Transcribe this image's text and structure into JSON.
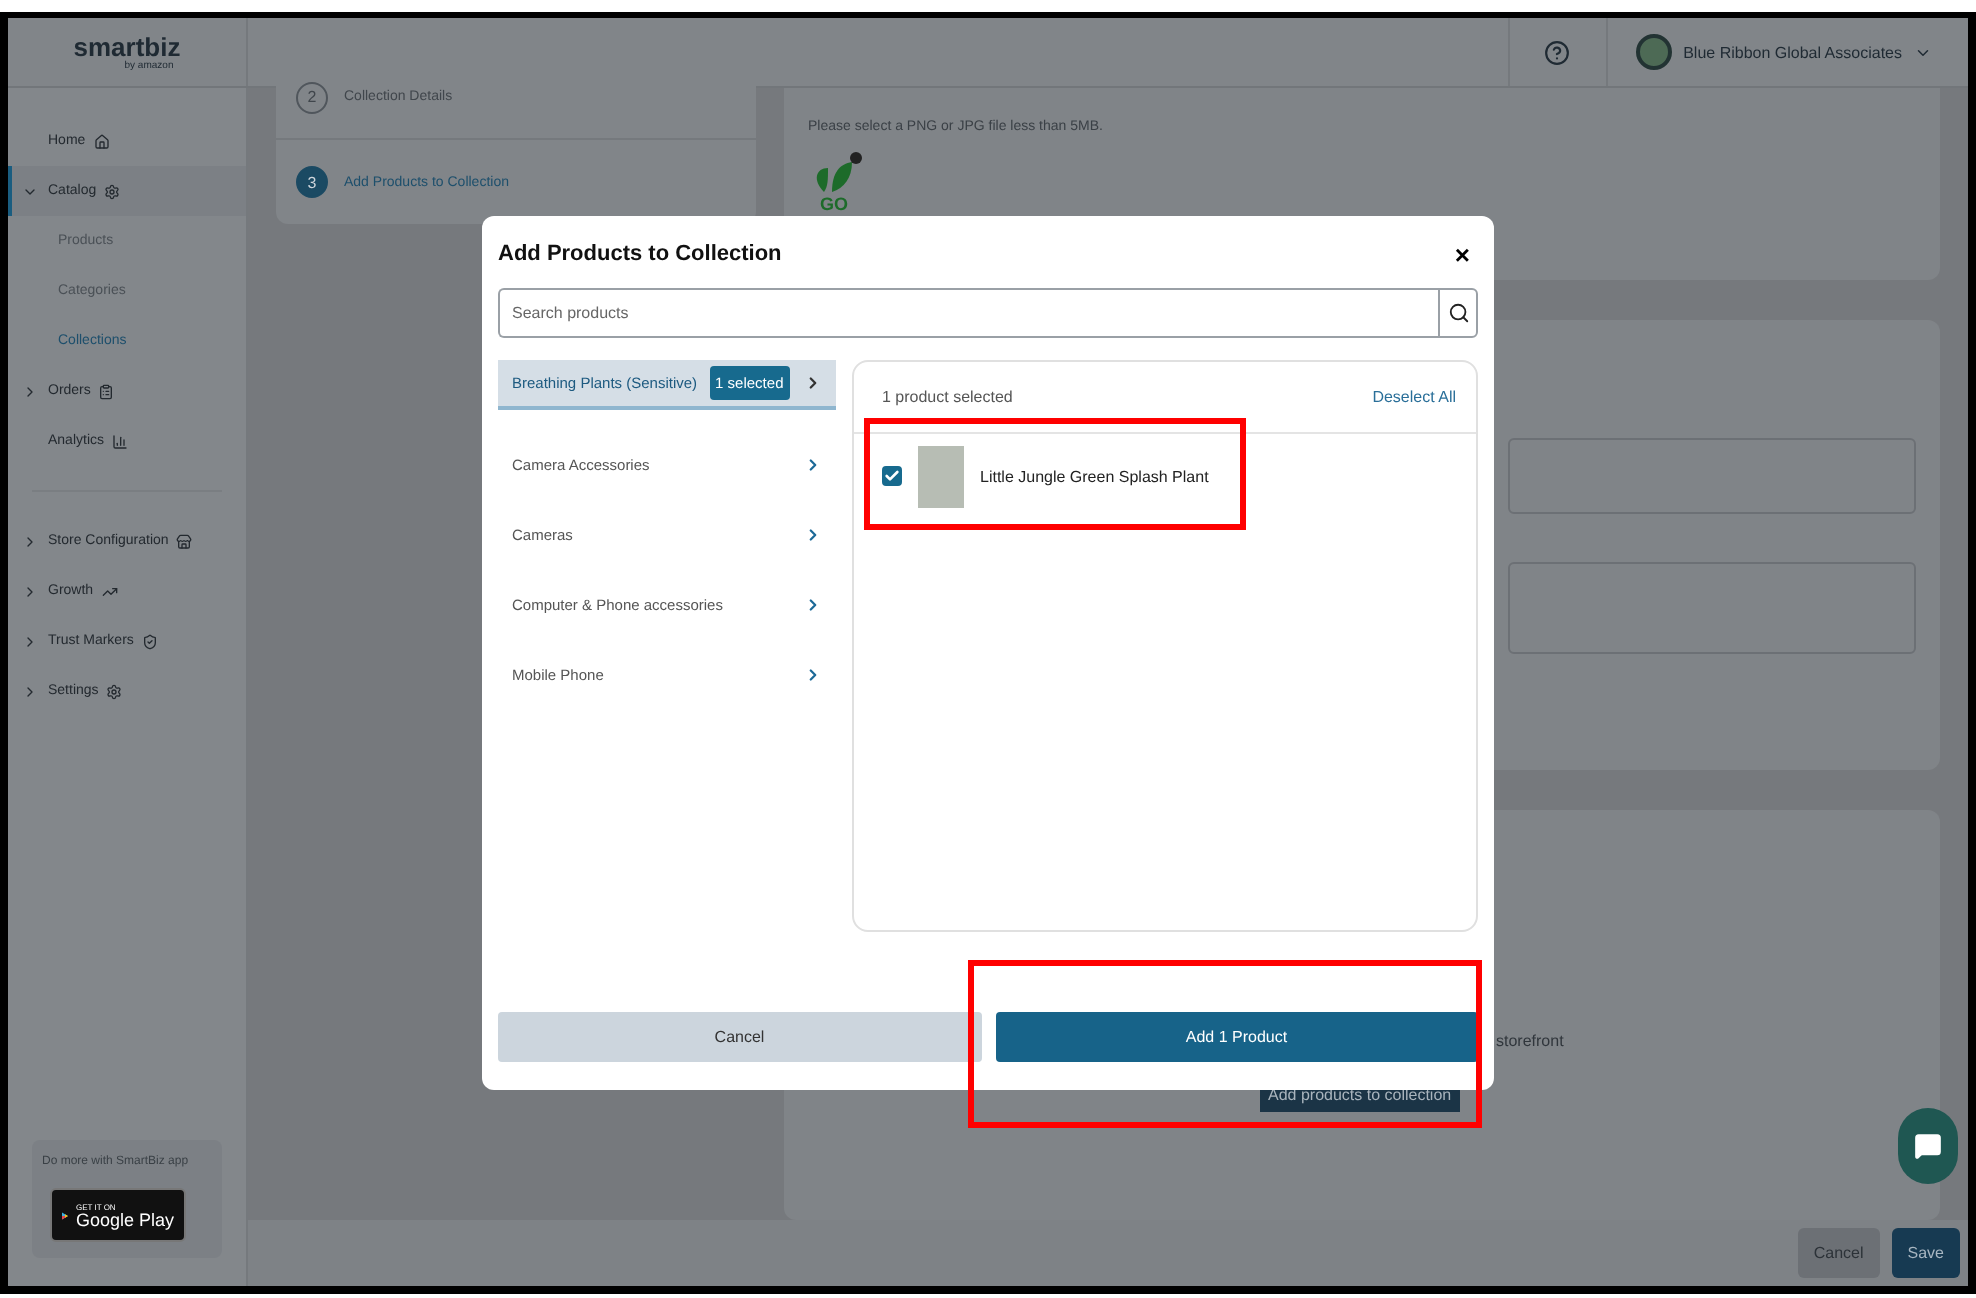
{
  "header": {
    "logo": "smartbiz",
    "logo_sub": "by amazon",
    "account": "Blue Ribbon Global Associates"
  },
  "sidebar": {
    "items": [
      {
        "label": "Home",
        "kind": "link",
        "selected": false
      },
      {
        "label": "Catalog",
        "kind": "group",
        "expanded": true,
        "selected": true,
        "children": [
          {
            "label": "Products",
            "selected": false
          },
          {
            "label": "Categories",
            "selected": false
          },
          {
            "label": "Collections",
            "selected": true
          }
        ]
      },
      {
        "label": "Orders",
        "kind": "group",
        "expanded": false,
        "selected": false
      },
      {
        "label": "Analytics",
        "kind": "link",
        "selected": false
      },
      {
        "kind": "divider"
      },
      {
        "label": "Store Configuration",
        "kind": "group",
        "expanded": false,
        "selected": false
      },
      {
        "label": "Growth",
        "kind": "group",
        "expanded": false,
        "selected": false
      },
      {
        "label": "Trust Markers",
        "kind": "group",
        "expanded": false,
        "selected": false
      },
      {
        "label": "Settings",
        "kind": "group",
        "expanded": false,
        "selected": false
      }
    ],
    "promo": {
      "text": "Do more with SmartBiz app",
      "badge_small": "GET IT ON",
      "badge_large": "Google Play"
    }
  },
  "steps": [
    {
      "number": "2",
      "label": "Collection Details",
      "selected": false
    },
    {
      "number": "3",
      "label": "Add Products to Collection",
      "selected": true
    }
  ],
  "upload": {
    "hint": "Please select a PNG or JPG file less than 5MB.",
    "logo_text": "GO"
  },
  "products_section": {
    "text_fragment": "storefront",
    "button": "Add products to collection"
  },
  "footer": {
    "cancel": "Cancel",
    "save": "Save"
  },
  "modal": {
    "title": "Add Products to Collection",
    "close": "×",
    "search": {
      "placeholder": "Search products"
    },
    "categories": [
      {
        "label": "Breathing Plants (Sensitive)",
        "selected": true,
        "badge": "1 selected"
      },
      {
        "label": "Camera Accessories",
        "selected": false
      },
      {
        "label": "Cameras",
        "selected": false
      },
      {
        "label": "Computer & Phone accessories",
        "selected": false
      },
      {
        "label": "Mobile Phone",
        "selected": false
      }
    ],
    "selected_count": "1 product selected",
    "deselect": "Deselect All",
    "products": [
      {
        "name": "Little Jungle Green Splash Plant",
        "checked": true,
        "highlighted": true
      }
    ],
    "cancel": "Cancel",
    "primary": "Add 1 Product",
    "primary_highlighted": true
  }
}
